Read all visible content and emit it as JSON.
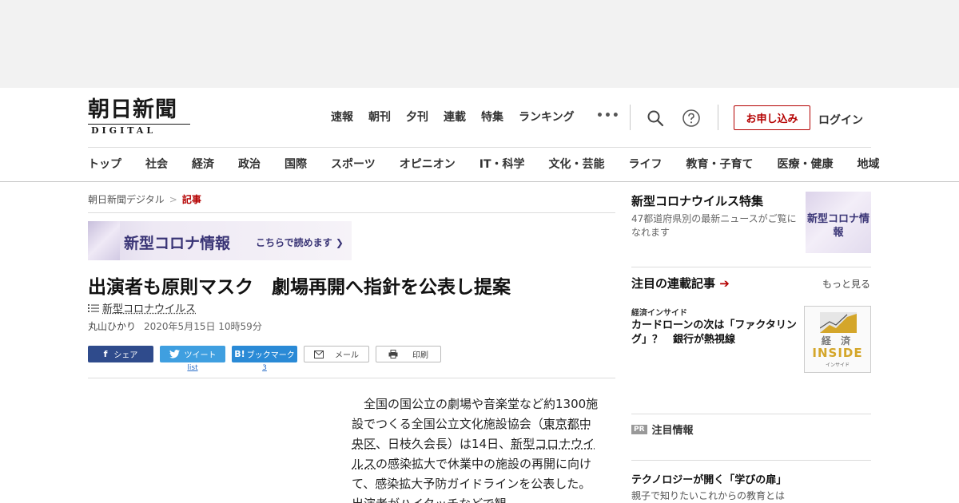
{
  "header": {
    "logo_kanji": "朝日新聞",
    "logo_sub": "DIGITAL",
    "top_nav": [
      "速報",
      "朝刊",
      "夕刊",
      "連載",
      "特集",
      "ランキング"
    ],
    "more": "•••",
    "apply": "お申し込み",
    "login": "ログイン",
    "categories": [
      "トップ",
      "社会",
      "経済",
      "政治",
      "国際",
      "スポーツ",
      "オピニオン",
      "IT・科学",
      "文化・芸能",
      "ライフ",
      "教育・子育て",
      "医療・健康",
      "地域"
    ]
  },
  "breadcrumb": {
    "home": "朝日新聞デジタル",
    "sep": ">",
    "current": "記事"
  },
  "banner": {
    "title": "新型コロナ情報",
    "link": "こちらで読めます ❯"
  },
  "article": {
    "headline": "出演者も原則マスク　劇場再開へ指針を公表し提案",
    "tag": "新型コロナウイルス",
    "author": "丸山ひかり",
    "date": "2020年5月15日 10時59分",
    "share": {
      "facebook": "シェア",
      "twitter": "ツイート",
      "twitter_count": "list",
      "hatena": "ブックマーク",
      "hatena_count": "3",
      "mail": "メール",
      "print": "印刷"
    },
    "body": {
      "p1": "　全国の国公立の劇場や音楽堂など約1300施設でつくる全国公立文化施設協会（",
      "link1": "東京都中央区",
      "p2": "、日枝久会長）は14日、",
      "link2": "新型コロナウイルス",
      "p3": "の感染拡大で休業中の施設の再開に向けて、感染拡大予防ガイドラインを公表した。出演者がハイタッチなどで観"
    }
  },
  "sidebar": {
    "feature": {
      "title": "新型コロナウイルス特集",
      "desc": "47都道府県別の最新ニュースがご覧になれます",
      "thumb": "新型コロナ情報"
    },
    "series": {
      "title": "注目の連載記事",
      "arrow": "➔",
      "more": "もっと見る",
      "item_category": "経済インサイド",
      "item_title": "カードローンの次は「ファクタリング」？　銀行が熱視線",
      "thumb_top": "経 済",
      "thumb_main": "INSIDE",
      "thumb_sub": "インサイド"
    },
    "pr": {
      "badge": "PR",
      "title": "注目情報",
      "item_title": "テクノロジーが開く「学びの扉」",
      "item_desc": "親子で知りたいこれからの教育とは"
    }
  },
  "colors": {
    "brand_red": "#b40000",
    "corona_purple": "#3a3576",
    "facebook": "#2f4b8c",
    "twitter": "#3f9fe0",
    "hatena": "#2a8ad6"
  }
}
